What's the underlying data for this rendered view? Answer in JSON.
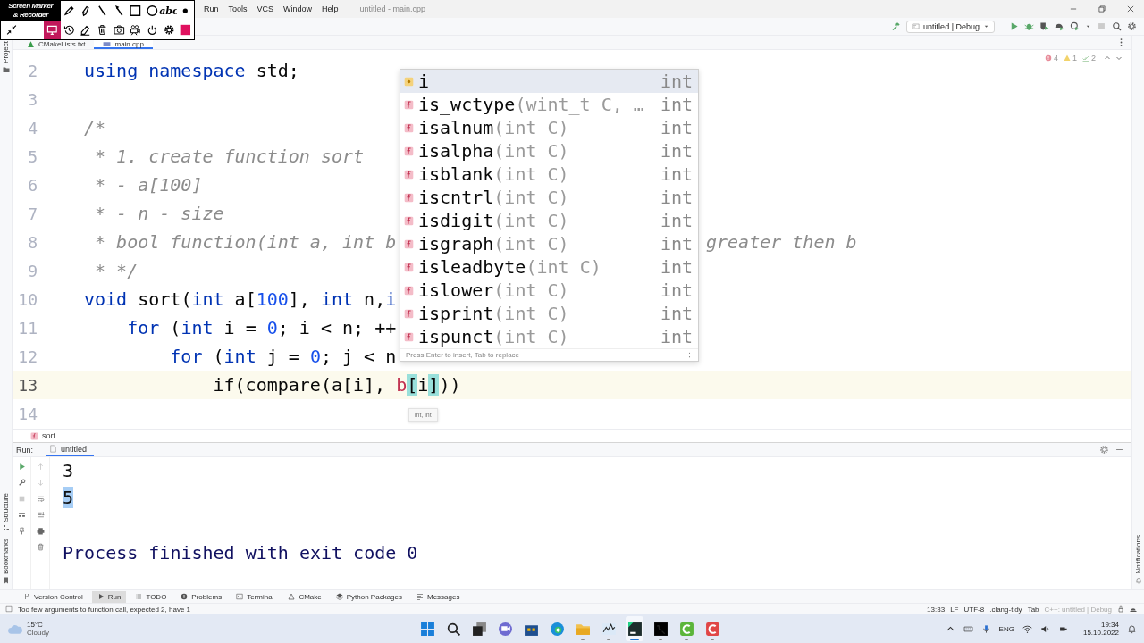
{
  "screen_marker": {
    "logo": [
      "Screen Marker",
      "& Recorder"
    ],
    "tools": [
      {
        "selected": false
      },
      {
        "selected": false
      },
      {
        "selected": false
      },
      {
        "selected": false
      },
      {
        "selected": false
      },
      {
        "selected": false
      },
      {
        "label": "abc",
        "selected": false
      },
      {
        "selected": false
      },
      {
        "selected": false
      },
      {
        "selected": true
      },
      {
        "selected": false
      },
      {
        "selected": false
      },
      {
        "selected": false
      },
      {
        "selected": false
      },
      {
        "selected": false
      },
      {
        "selected": false
      },
      {
        "selected": false
      },
      {
        "selected": false
      }
    ]
  },
  "title_bar": {
    "menu": [
      "Run",
      "Tools",
      "VCS",
      "Window",
      "Help"
    ],
    "title": "untitled - main.cpp"
  },
  "toolbar": {
    "run_config": "untitled | Debug"
  },
  "tabs": [
    {
      "label": "CMakeLists.txt",
      "selected": false
    },
    {
      "label": "main.cpp",
      "selected": true
    }
  ],
  "side_strips": {
    "left_top": [
      "Project"
    ],
    "left_bottom": [
      "Structure",
      "Bookmarks"
    ],
    "right": [
      "Notifications"
    ]
  },
  "inspections": {
    "errors": "4",
    "warnings": "1",
    "typos": "2"
  },
  "editor": {
    "lines": [
      {
        "number": "2",
        "current": false,
        "tokens": [
          {
            "kind": "kw",
            "text": "using namespace"
          },
          {
            "kind": "plain",
            "text": " std;"
          }
        ]
      },
      {
        "number": "3",
        "current": false
      },
      {
        "number": "4",
        "current": false,
        "tokens": [
          {
            "kind": "comment",
            "text": "/*"
          }
        ]
      },
      {
        "number": "5",
        "current": false,
        "tokens": [
          {
            "kind": "comment",
            "text": " * 1. create function sort"
          }
        ]
      },
      {
        "number": "6",
        "current": false,
        "tokens": [
          {
            "kind": "comment",
            "text": " * - a[100]"
          }
        ]
      },
      {
        "number": "7",
        "current": false,
        "tokens": [
          {
            "kind": "comment",
            "text": " * - n - size"
          }
        ]
      },
      {
        "number": "8",
        "current": false,
        "tokens": [
          {
            "kind": "comment",
            "text": " * bool function(int a, int b"
          }
        ],
        "tail": "greater then b"
      },
      {
        "number": "9",
        "current": false,
        "tokens": [
          {
            "kind": "comment",
            "text": " * */"
          }
        ]
      },
      {
        "number": "10",
        "current": false,
        "tokens": [
          {
            "kind": "kw",
            "text": "void"
          },
          {
            "kind": "plain",
            "text": " sort("
          },
          {
            "kind": "kw",
            "text": "int"
          },
          {
            "kind": "plain",
            "text": " a["
          },
          {
            "kind": "num",
            "text": "100"
          },
          {
            "kind": "plain",
            "text": "], "
          },
          {
            "kind": "kw",
            "text": "int"
          },
          {
            "kind": "plain",
            "text": " n,"
          },
          {
            "kind": "kw",
            "text": "i"
          }
        ]
      },
      {
        "number": "11",
        "current": false,
        "tokens": [
          {
            "kind": "kw",
            "text": "    for"
          },
          {
            "kind": "plain",
            "text": " ("
          },
          {
            "kind": "kw",
            "text": "int"
          },
          {
            "kind": "plain",
            "text": " i = "
          },
          {
            "kind": "num",
            "text": "0"
          },
          {
            "kind": "plain",
            "text": "; i < n; ++"
          }
        ]
      },
      {
        "number": "12",
        "current": false,
        "tokens": [
          {
            "kind": "kw",
            "text": "        for"
          },
          {
            "kind": "plain",
            "text": " ("
          },
          {
            "kind": "kw",
            "text": "int"
          },
          {
            "kind": "plain",
            "text": " j = "
          },
          {
            "kind": "num",
            "text": "0"
          },
          {
            "kind": "plain",
            "text": "; j < n"
          }
        ]
      },
      {
        "number": "13",
        "current": true,
        "tokens": [
          {
            "kind": "plain",
            "text": "            if(compare(a[i], "
          },
          {
            "kind": "param",
            "text": "b"
          },
          {
            "kind": "match",
            "text": "["
          },
          {
            "kind": "plain",
            "text": "i"
          },
          {
            "kind": "match",
            "text": "]"
          },
          {
            "kind": "plain",
            "text": "))"
          }
        ]
      },
      {
        "number": "14",
        "current": false
      }
    ]
  },
  "completion": {
    "items": [
      {
        "kind": "variable",
        "name": "i",
        "type": "int",
        "selected": true
      },
      {
        "kind": "function",
        "name": "is_wctype",
        "params": "(wint_t C, …",
        "type": "int",
        "selected": false
      },
      {
        "kind": "function",
        "name": "isalnum",
        "params": "(int C)",
        "type": "int",
        "selected": false
      },
      {
        "kind": "function",
        "name": "isalpha",
        "params": "(int C)",
        "type": "int",
        "selected": false
      },
      {
        "kind": "function",
        "name": "isblank",
        "params": "(int C)",
        "type": "int",
        "selected": false
      },
      {
        "kind": "function",
        "name": "iscntrl",
        "params": "(int C)",
        "type": "int",
        "selected": false
      },
      {
        "kind": "function",
        "name": "isdigit",
        "params": "(int C)",
        "type": "int",
        "selected": false
      },
      {
        "kind": "function",
        "name": "isgraph",
        "params": "(int C)",
        "type": "int",
        "selected": false
      },
      {
        "kind": "function",
        "name": "isleadbyte",
        "params": "(int C)",
        "type": "int",
        "selected": false
      },
      {
        "kind": "function",
        "name": "islower",
        "params": "(int C)",
        "type": "int",
        "selected": false
      },
      {
        "kind": "function",
        "name": "isprint",
        "params": "(int C)",
        "type": "int",
        "selected": false
      },
      {
        "kind": "function",
        "name": "ispunct",
        "params": "(int C)",
        "type": "int",
        "selected": false
      }
    ],
    "footer": "Press Enter to insert, Tab to replace"
  },
  "tooltip": "int, int",
  "breadcrumb": "sort",
  "run_panel": {
    "label": "Run:",
    "tab": "untitled",
    "output": [
      {
        "text": "3",
        "selected": false
      },
      {
        "text": "5",
        "selected": true
      }
    ],
    "exit_message": "Process finished with exit code 0"
  },
  "tool_tabs": [
    {
      "label": "Version Control",
      "selected": false
    },
    {
      "label": "Run",
      "selected": true
    },
    {
      "label": "TODO",
      "selected": false
    },
    {
      "label": "Problems",
      "selected": false
    },
    {
      "label": "Terminal",
      "selected": false
    },
    {
      "label": "CMake",
      "selected": false
    },
    {
      "label": "Python Packages",
      "selected": false
    },
    {
      "label": "Messages",
      "selected": false
    }
  ],
  "status_bar": {
    "message": "Too few arguments to function call, expected 2, have 1",
    "items": [
      {
        "text": "13:33",
        "disabled": false
      },
      {
        "text": "LF",
        "disabled": false
      },
      {
        "text": "UTF-8",
        "disabled": false
      },
      {
        "text": ".clang-tidy",
        "disabled": false
      },
      {
        "text": "Tab",
        "disabled": false
      },
      {
        "text": "C++: untitled | Debug",
        "disabled": true
      }
    ]
  },
  "taskbar": {
    "weather": {
      "temp": "15°C",
      "condition": "Cloudy"
    },
    "apps": [
      {
        "running": false,
        "active": false
      },
      {
        "running": false,
        "active": false
      },
      {
        "running": false,
        "active": false
      },
      {
        "running": false,
        "active": false
      },
      {
        "running": false,
        "active": false
      },
      {
        "running": false,
        "active": false
      },
      {
        "running": true,
        "active": false
      },
      {
        "running": true,
        "active": false
      },
      {
        "running": true,
        "active": true
      },
      {
        "running": true,
        "active": false
      },
      {
        "running": true,
        "active": false
      },
      {
        "running": true,
        "active": false
      }
    ],
    "language": "ENG",
    "time": "19:34",
    "date": "15.10.2022"
  }
}
